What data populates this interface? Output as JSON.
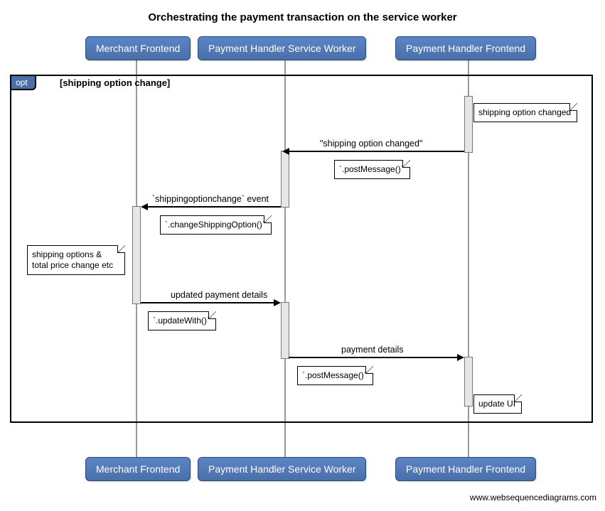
{
  "title": "Orchestrating the payment transaction on the service worker",
  "participants": {
    "p1": "Merchant Frontend",
    "p2": "Payment Handler Service Worker",
    "p3": "Payment Handler Frontend"
  },
  "opt": {
    "label": "opt",
    "guard": "[shipping option change]"
  },
  "notes": {
    "n1": "shipping option changed",
    "n2": "`.postMessage()`",
    "n3": "`.changeShippingOption()`",
    "n4": "shipping options & total price change etc",
    "n5": "`.updateWith()`",
    "n6": "`.postMessage()`",
    "n7": "update UI"
  },
  "messages": {
    "m1": "\"shipping option changed\"",
    "m2": "`shippingoptionchange` event",
    "m3": "updated payment details",
    "m4": "payment details"
  },
  "attribution": "www.websequencediagrams.com",
  "chart_data": {
    "type": "sequence-diagram",
    "title": "Orchestrating the payment transaction on the service worker",
    "participants": [
      "Merchant Frontend",
      "Payment Handler Service Worker",
      "Payment Handler Frontend"
    ],
    "fragments": [
      {
        "type": "opt",
        "guard": "shipping option change",
        "steps": [
          {
            "type": "note",
            "over": "Payment Handler Frontend",
            "text": "shipping option changed"
          },
          {
            "type": "message",
            "from": "Payment Handler Frontend",
            "to": "Payment Handler Service Worker",
            "label": "\"shipping option changed\"",
            "call": ".postMessage()"
          },
          {
            "type": "message",
            "from": "Payment Handler Service Worker",
            "to": "Merchant Frontend",
            "label": "`shippingoptionchange` event",
            "call": ".changeShippingOption()"
          },
          {
            "type": "note",
            "over": "Merchant Frontend",
            "text": "shipping options & total price change etc"
          },
          {
            "type": "message",
            "from": "Merchant Frontend",
            "to": "Payment Handler Service Worker",
            "label": "updated payment details",
            "call": ".updateWith()"
          },
          {
            "type": "message",
            "from": "Payment Handler Service Worker",
            "to": "Payment Handler Frontend",
            "label": "payment details",
            "call": ".postMessage()"
          },
          {
            "type": "note",
            "over": "Payment Handler Frontend",
            "text": "update UI"
          }
        ]
      }
    ]
  }
}
